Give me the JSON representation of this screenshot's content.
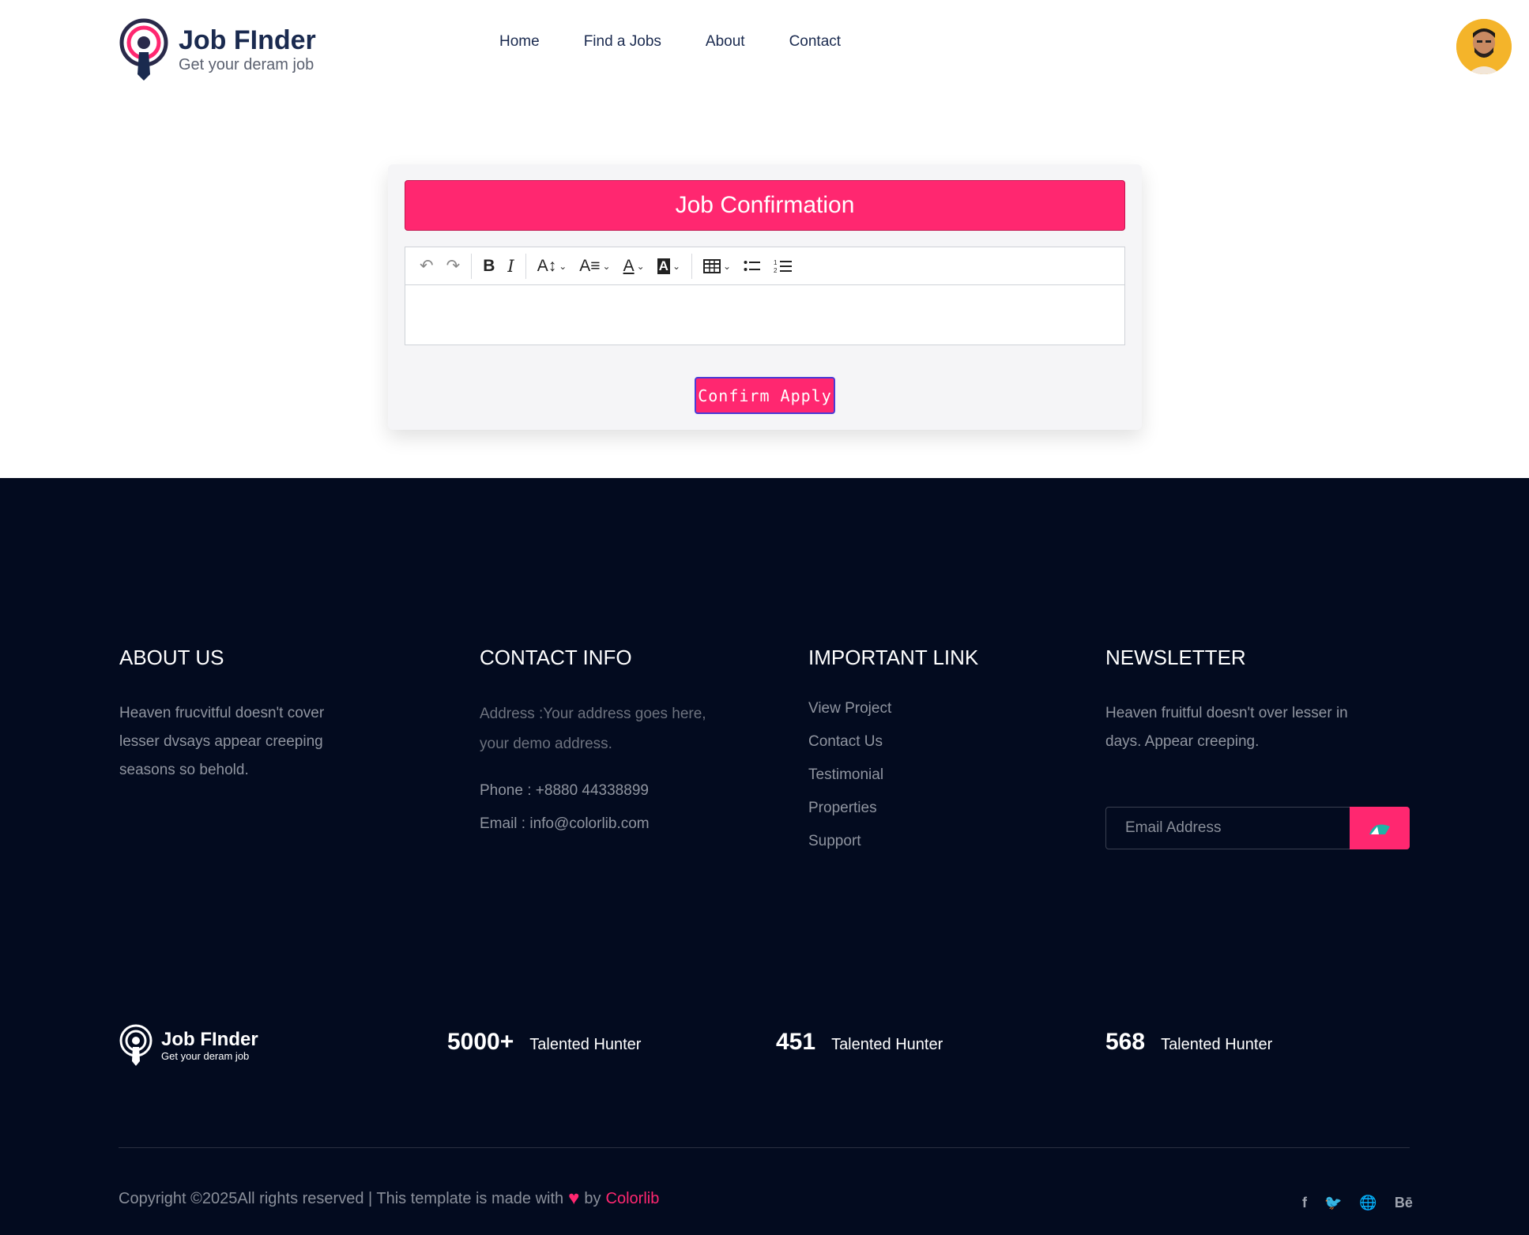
{
  "header": {
    "logo_title": "Job FInder",
    "logo_subtitle": "Get your deram job",
    "nav": [
      "Home",
      "Find a Jobs",
      "About",
      "Contact"
    ]
  },
  "card": {
    "title": "Job Confirmation",
    "toolbar": {
      "undo_icon": "undo-icon",
      "redo_icon": "redo-icon",
      "bold": "B",
      "italic": "I",
      "font_size": "A↕",
      "font_family": "A≡",
      "font_color": "A",
      "bg_color": "A",
      "table_icon": "table-icon",
      "bullet_list_icon": "bullet-list-icon",
      "numbered_list_icon": "numbered-list-icon"
    },
    "confirm_label": "Confirm Apply"
  },
  "footer": {
    "about": {
      "title": "ABOUT US",
      "lines": [
        "Heaven frucvitful doesn't cover",
        "lesser dvsays appear creeping",
        "seasons so behold."
      ]
    },
    "contact": {
      "title": "CONTACT INFO",
      "address_lines": [
        "Address :Your address goes here,",
        "your demo address."
      ],
      "phone": "Phone : +8880 44338899",
      "email": "Email : info@colorlib.com"
    },
    "links": {
      "title": "IMPORTANT LINK",
      "items": [
        "View Project",
        "Contact Us",
        "Testimonial",
        "Properties",
        "Support"
      ]
    },
    "newsletter": {
      "title": "NEWSLETTER",
      "lines": [
        "Heaven fruitful doesn't over lesser in",
        "days. Appear creeping."
      ],
      "placeholder": "Email Address"
    },
    "logo_title": "Job FInder",
    "logo_subtitle": "Get your deram job",
    "stats": [
      {
        "num": "5000+",
        "label": "Talented Hunter"
      },
      {
        "num": "451",
        "label": "Talented Hunter"
      },
      {
        "num": "568",
        "label": "Talented Hunter"
      }
    ],
    "copyright_text": "Copyright ©2025All rights reserved | This template is made with",
    "copyright_by": "by",
    "copyright_brand": "Colorlib",
    "socials": [
      "f",
      "🐦",
      "🌐",
      "Bē"
    ]
  },
  "colors": {
    "accent": "#ff2770",
    "dark_bg": "#030b1f",
    "navy": "#1a2a4f"
  }
}
